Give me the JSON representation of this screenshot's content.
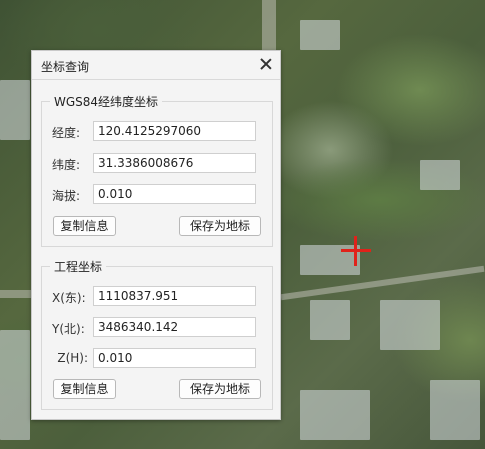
{
  "dialog": {
    "title": "坐标查询",
    "wgs84": {
      "title": "WGS84经纬度坐标",
      "longitude_label": "经度:",
      "longitude_value": "120.4125297060",
      "latitude_label": "纬度:",
      "latitude_value": "31.3386008676",
      "altitude_label": "海拔:",
      "altitude_value": "0.010",
      "copy_button": "复制信息",
      "save_button": "保存为地标"
    },
    "engineering": {
      "title": "工程坐标",
      "x_label": "X(东):",
      "x_value": "1110837.951",
      "y_label": "Y(北):",
      "y_value": "3486340.142",
      "z_label": "Z(H):",
      "z_value": "0.010",
      "copy_button": "复制信息",
      "save_button": "保存为地标"
    }
  },
  "colors": {
    "marker": "#e0221a",
    "dialog_bg": "#f4f4f4"
  },
  "icons": {
    "close": "close-icon",
    "marker": "crosshair-icon"
  }
}
